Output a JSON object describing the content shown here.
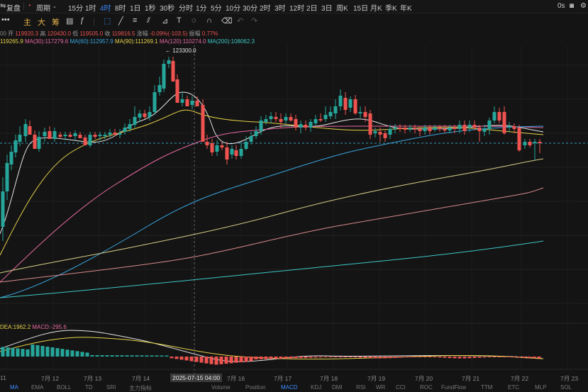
{
  "toolbar": {
    "adjust_label": "复盘",
    "period_label": "周期",
    "intervals": [
      "15分",
      "1时",
      "4时",
      "8时",
      "1日",
      "1秒",
      "30秒",
      "分时",
      "1分",
      "5分",
      "10分",
      "30分",
      "2时",
      "3时",
      "12时",
      "2日",
      "3日",
      "周K",
      "15日",
      "月K",
      "季K",
      "年K"
    ],
    "active_interval": "4时",
    "right_label": "0s"
  },
  "indicator_tabs": {
    "main": "主",
    "big": "大",
    "chips": "筹"
  },
  "ohlc": {
    "open_label": "开",
    "open": "119920.3",
    "high_label": "高",
    "high": "120430.0",
    "low_label": "低",
    "low": "119505.0",
    "close_label": "收",
    "close": "119816.5",
    "change_label": "涨幅",
    "change": "-0.09%(-103.5)",
    "amplitude_label": "振幅",
    "amplitude": "0.77%"
  },
  "ma_legend": {
    "ma15": "119265.9",
    "ma30": "MA(30):117279.6",
    "ma60": "MA(60):112957.9",
    "ma90": "MA(90):111269.1",
    "ma120": "MA(120):110274.0",
    "ma200": "MA(200):108062.3"
  },
  "price_marker": "123300.0",
  "macd_legend": {
    "dea": "DEA:1962.2",
    "macd": "MACD:-295.6"
  },
  "x_axis": {
    "labels": [
      "11",
      "7月 12",
      "7月 13",
      "7月 14",
      "7月 16",
      "7月 17",
      "7月 18",
      "7月 19",
      "7月 20",
      "7月 21",
      "7月 22",
      "7月 23"
    ],
    "crosshair_label": "2025-07-15 04:00"
  },
  "bottom_tabs": [
    "MA",
    "EMA",
    "BOLL",
    "TD",
    "SRI",
    "主力指标",
    "Volume",
    "Position",
    "MACD",
    "KDJ",
    "DMI",
    "RSI",
    "WR",
    "CCI",
    "ROC",
    "FundFlow",
    "TTM",
    "ETC",
    "MLP",
    "SOL"
  ],
  "colors": {
    "up": "#26a69a",
    "down": "#ef5350",
    "accent": "#3d8bff",
    "ma_white": "#e6e6e6",
    "ma_yellow": "#e8d24a",
    "ma_pink": "#e86aa2",
    "ma_blue": "#39a6e0",
    "ma_khaki": "#d8d08a",
    "ma_salmon": "#d98a8a",
    "ma_cyan": "#3fc7c7"
  }
}
